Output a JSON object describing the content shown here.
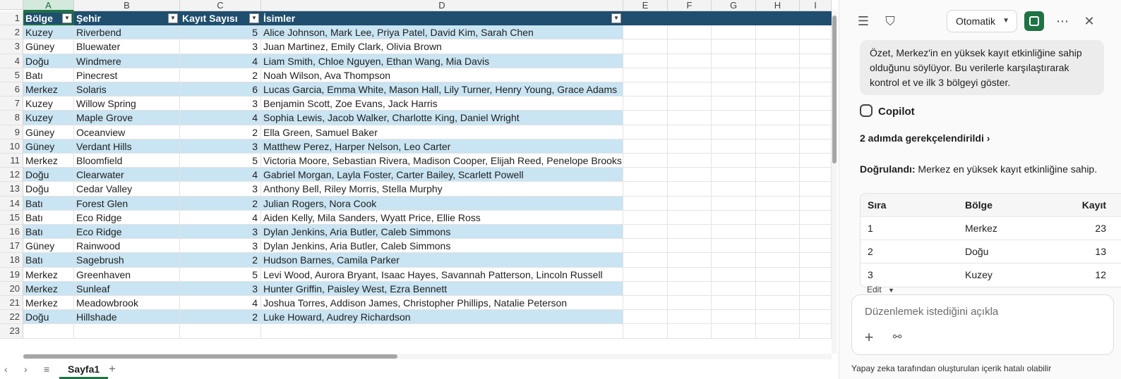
{
  "sheet": {
    "columns": [
      "A",
      "B",
      "C",
      "D",
      "E",
      "F",
      "G",
      "H",
      "I"
    ],
    "selected_column": "A",
    "table_headers": [
      "Bölge",
      "Şehir",
      "Kayıt Sayısı",
      "İsimler"
    ],
    "row_numbers": [
      "1",
      "2",
      "3",
      "4",
      "5",
      "6",
      "7",
      "8",
      "9",
      "10",
      "11",
      "12",
      "13",
      "14",
      "15",
      "16",
      "17",
      "18",
      "19",
      "20",
      "21",
      "22",
      "23"
    ],
    "rows": [
      [
        "Kuzey",
        "Riverbend",
        "5",
        "Alice Johnson, Mark Lee, Priya Patel, David Kim, Sarah Chen"
      ],
      [
        "Güney",
        "Bluewater",
        "3",
        "Juan Martinez, Emily Clark, Olivia Brown"
      ],
      [
        "Doğu",
        "Windmere",
        "4",
        "Liam Smith, Chloe Nguyen, Ethan Wang, Mia Davis"
      ],
      [
        "Batı",
        "Pinecrest",
        "2",
        "Noah Wilson, Ava Thompson"
      ],
      [
        "Merkez",
        "Solaris",
        "6",
        "Lucas Garcia, Emma White, Mason Hall, Lily Turner, Henry Young, Grace Adams"
      ],
      [
        "Kuzey",
        "Willow Spring",
        "3",
        "Benjamin Scott, Zoe Evans, Jack Harris"
      ],
      [
        "Kuzey",
        "Maple Grove",
        "4",
        "Sophia Lewis, Jacob Walker, Charlotte King, Daniel Wright"
      ],
      [
        "Güney",
        "Oceanview",
        "2",
        "Ella Green, Samuel Baker"
      ],
      [
        "Güney",
        "Verdant Hills",
        "3",
        "Matthew Perez, Harper Nelson, Leo Carter"
      ],
      [
        "Merkez",
        "Bloomfield",
        "5",
        "Victoria Moore, Sebastian Rivera, Madison Cooper, Elijah Reed, Penelope Brooks"
      ],
      [
        "Doğu",
        "Clearwater",
        "4",
        "Gabriel Morgan, Layla Foster, Carter Bailey, Scarlett Powell"
      ],
      [
        "Doğu",
        "Cedar Valley",
        "3",
        "Anthony Bell, Riley Morris, Stella Murphy"
      ],
      [
        "Batı",
        "Forest Glen",
        "2",
        "Julian Rogers, Nora Cook"
      ],
      [
        "Batı",
        "Eco Ridge",
        "4",
        "Aiden Kelly, Mila Sanders, Wyatt Price, Ellie Ross"
      ],
      [
        "Batı",
        "Eco Ridge",
        "3",
        "Dylan Jenkins, Aria Butler, Caleb Simmons"
      ],
      [
        "Güney",
        "Rainwood",
        "3",
        "Dylan Jenkins, Aria Butler, Caleb Simmons"
      ],
      [
        "Batı",
        "Sagebrush",
        "2",
        "Hudson Barnes, Camila Parker"
      ],
      [
        "Merkez",
        "Greenhaven",
        "5",
        "Levi Wood, Aurora Bryant, Isaac Hayes, Savannah Patterson, Lincoln Russell"
      ],
      [
        "Merkez",
        "Sunleaf",
        "3",
        "Hunter Griffin, Paisley West, Ezra Bennett"
      ],
      [
        "Merkez",
        "Meadowbrook",
        "4",
        "Joshua Torres, Addison James, Christopher Phillips, Natalie Peterson"
      ],
      [
        "Doğu",
        "Hillshade",
        "2",
        "Luke Howard, Audrey Richardson"
      ]
    ],
    "tab_name": "Sayfa1",
    "colors": {
      "header_bg": "#1f4e6e",
      "band": "#c9e4f2",
      "accent": "#1f7244"
    }
  },
  "panel": {
    "mode_label": "Otomatik",
    "user_message": "Özet, Merkez'in en yüksek kayıt etkinliğine sahip olduğunu söylüyor. Bu verilerle karşılaştırarak kontrol et ve ilk 3 bölgeyi göster.",
    "copilot_label": "Copilot",
    "reasoned_label": "2 adımda gerekçelendirildi",
    "verified_prefix": "Doğrulandı:",
    "verified_text": " Merkez en yüksek kayıt etkinliğine sahip.",
    "table_headers": [
      "Sıra",
      "Bölge",
      "Kayıt"
    ],
    "table_rows": [
      [
        "1",
        "Merkez",
        "23"
      ],
      [
        "2",
        "Doğu",
        "13"
      ],
      [
        "3",
        "Kuzey",
        "12"
      ]
    ],
    "edit_label": "Edit",
    "prompt_placeholder": "Düzenlemek istediğini açıkla",
    "disclaimer": "Yapay zeka tarafından oluşturulan içerik hatalı olabilir"
  }
}
